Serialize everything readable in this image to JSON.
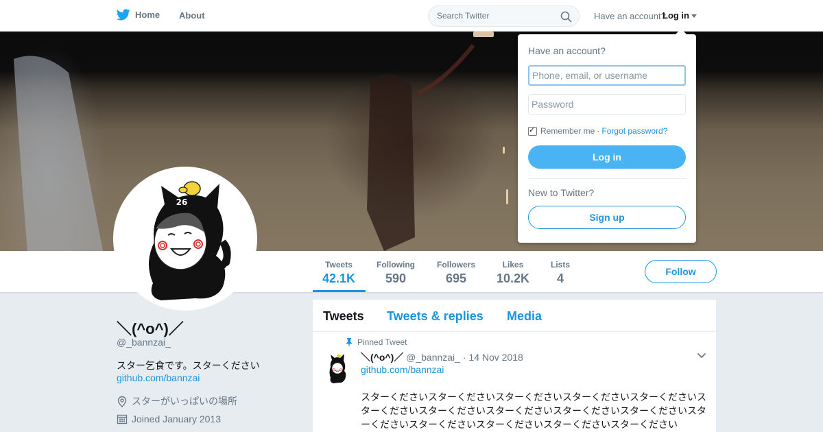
{
  "nav": {
    "home": "Home",
    "about": "About",
    "search_placeholder": "Search Twitter",
    "have_account": "Have an account?",
    "login": "Log in",
    "brand_color": "#1da1f2"
  },
  "login_dropdown": {
    "title": "Have an account?",
    "username_placeholder": "Phone, email, or username",
    "password_placeholder": "Password",
    "remember_me": "Remember me",
    "separator": "·",
    "forgot_password": "Forgot password?",
    "remember_checked": true,
    "login_button": "Log in",
    "new_to_twitter": "New to Twitter?",
    "signup_button": "Sign up"
  },
  "stats": [
    {
      "label": "Tweets",
      "value": "42.1K"
    },
    {
      "label": "Following",
      "value": "590"
    },
    {
      "label": "Followers",
      "value": "695"
    },
    {
      "label": "Likes",
      "value": "10.2K"
    },
    {
      "label": "Lists",
      "value": "4"
    }
  ],
  "follow_button": "Follow",
  "profile": {
    "name": "＼(^o^)／",
    "handle": "@_bannzai_",
    "bio": "スター乞食です。スターください",
    "link": "github.com/bannzai",
    "location": "スターがいっぱいの場所",
    "joined": "Joined January 2013",
    "avatar_badge": "26"
  },
  "tabs": [
    "Tweets",
    "Tweets & replies",
    "Media"
  ],
  "tweet": {
    "pinned_label": "Pinned Tweet",
    "name": "＼(^o^)／",
    "handle": "@_bannzai_",
    "separator": "·",
    "date": "14 Nov 2018",
    "link": "github.com/bannzai",
    "text": "スターくださいスターくださいスターくださいスターくださいスターくださいスターくださいスターくださいスターくださいスターくださいスターくださいスターくださいスターくださいスターくださいスターくださいスターください"
  },
  "colors": {
    "accent": "#1b95e0",
    "login_button": "#4ab3f4",
    "page_background": "#e6ecf0"
  }
}
